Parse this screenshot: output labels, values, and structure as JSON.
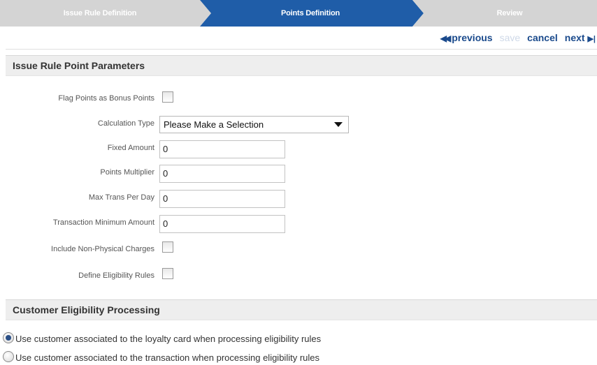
{
  "wizard": {
    "steps": [
      {
        "label": "Issue Rule Definition",
        "state": "complete"
      },
      {
        "label": "Points Definition",
        "state": "active"
      },
      {
        "label": "Review",
        "state": "pending"
      }
    ],
    "colors": {
      "inactive": "#d4d4d4",
      "active": "#1f5da8"
    }
  },
  "nav": {
    "previous": "previous",
    "save": "save",
    "cancel": "cancel",
    "next": "next",
    "previous_icon": "double-left-arrow",
    "next_icon": "play-end-arrow"
  },
  "sections": {
    "params_title": "Issue Rule Point Parameters",
    "eligibility_title": "Customer Eligibility Processing"
  },
  "fields": {
    "flag_bonus": {
      "label": "Flag Points as Bonus Points",
      "checked": false
    },
    "calc_type": {
      "label": "Calculation Type",
      "value": "Please Make a Selection"
    },
    "fixed_amount": {
      "label": "Fixed Amount",
      "value": "0"
    },
    "points_multiplier": {
      "label": "Points Multiplier",
      "value": "0"
    },
    "max_trans": {
      "label": "Max Trans Per Day",
      "value": "0"
    },
    "trans_min": {
      "label": "Transaction Minimum Amount",
      "value": "0"
    },
    "non_physical": {
      "label": "Include Non-Physical Charges",
      "checked": false
    },
    "eligibility_rules": {
      "label": "Define Eligibility Rules",
      "checked": false
    }
  },
  "eligibility": {
    "options": [
      {
        "label": "Use customer associated to the loyalty card when processing eligibility rules",
        "selected": true
      },
      {
        "label": "Use customer associated to the transaction when processing eligibility rules",
        "selected": false
      }
    ]
  }
}
